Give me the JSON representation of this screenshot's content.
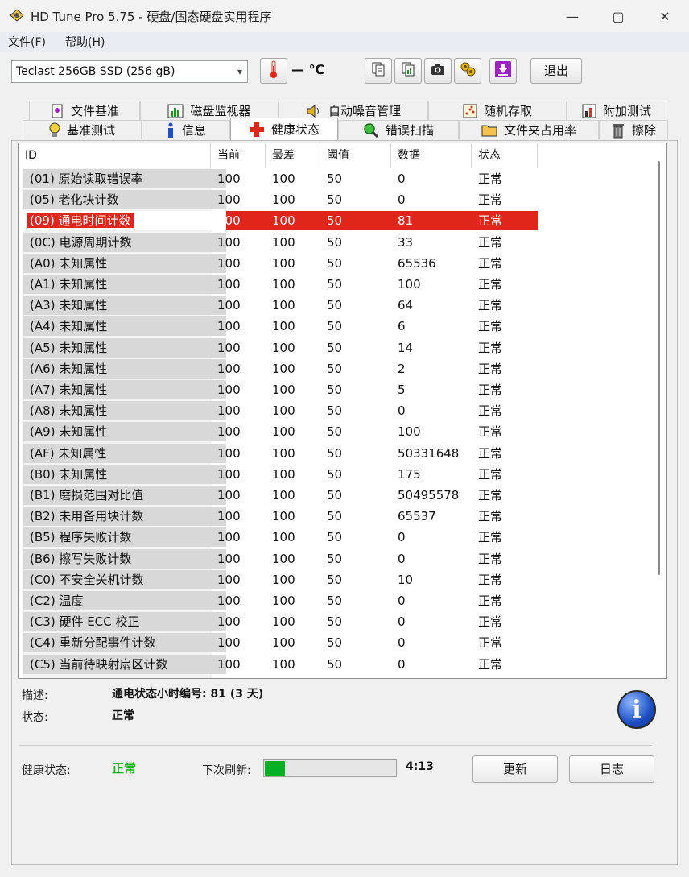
{
  "window": {
    "title": "HD Tune Pro 5.75 - 硬盘/固态硬盘实用程序",
    "minimize": "—",
    "maximize": "▢",
    "close": "✕"
  },
  "menu": {
    "file": "文件(F)",
    "help": "帮助(H)"
  },
  "toolbar": {
    "drive": "Teclast 256GB SSD (256 gB)",
    "temperature": "— ℃",
    "exit": "退出"
  },
  "tabs": {
    "row1": [
      "文件基准",
      "磁盘监视器",
      "自动噪音管理",
      "随机存取",
      "附加测试"
    ],
    "row2": [
      "基准测试",
      "信息",
      "健康状态",
      "错误扫描",
      "文件夹占用率",
      "擦除"
    ],
    "active": "健康状态"
  },
  "table": {
    "headers": [
      "ID",
      "当前",
      "最差",
      "阈值",
      "数据",
      "状态"
    ],
    "selected_index": 2,
    "rows": [
      [
        "(01) 原始读取错误率",
        "100",
        "100",
        "50",
        "0",
        "正常"
      ],
      [
        "(05) 老化块计数",
        "100",
        "100",
        "50",
        "0",
        "正常"
      ],
      [
        "(09) 通电时间计数",
        "100",
        "100",
        "50",
        "81",
        "正常"
      ],
      [
        "(0C) 电源周期计数",
        "100",
        "100",
        "50",
        "33",
        "正常"
      ],
      [
        "(A0) 未知属性",
        "100",
        "100",
        "50",
        "65536",
        "正常"
      ],
      [
        "(A1) 未知属性",
        "100",
        "100",
        "50",
        "100",
        "正常"
      ],
      [
        "(A3) 未知属性",
        "100",
        "100",
        "50",
        "64",
        "正常"
      ],
      [
        "(A4) 未知属性",
        "100",
        "100",
        "50",
        "6",
        "正常"
      ],
      [
        "(A5) 未知属性",
        "100",
        "100",
        "50",
        "14",
        "正常"
      ],
      [
        "(A6) 未知属性",
        "100",
        "100",
        "50",
        "2",
        "正常"
      ],
      [
        "(A7) 未知属性",
        "100",
        "100",
        "50",
        "5",
        "正常"
      ],
      [
        "(A8) 未知属性",
        "100",
        "100",
        "50",
        "0",
        "正常"
      ],
      [
        "(A9) 未知属性",
        "100",
        "100",
        "50",
        "100",
        "正常"
      ],
      [
        "(AF) 未知属性",
        "100",
        "100",
        "50",
        "50331648",
        "正常"
      ],
      [
        "(B0) 未知属性",
        "100",
        "100",
        "50",
        "175",
        "正常"
      ],
      [
        "(B1) 磨损范围对比值",
        "100",
        "100",
        "50",
        "50495578",
        "正常"
      ],
      [
        "(B2) 未用备用块计数",
        "100",
        "100",
        "50",
        "65537",
        "正常"
      ],
      [
        "(B5) 程序失败计数",
        "100",
        "100",
        "50",
        "0",
        "正常"
      ],
      [
        "(B6) 擦写失败计数",
        "100",
        "100",
        "50",
        "0",
        "正常"
      ],
      [
        "(C0) 不安全关机计数",
        "100",
        "100",
        "50",
        "10",
        "正常"
      ],
      [
        "(C2) 温度",
        "100",
        "100",
        "50",
        "0",
        "正常"
      ],
      [
        "(C3) 硬件 ECC 校正",
        "100",
        "100",
        "50",
        "0",
        "正常"
      ],
      [
        "(C4) 重新分配事件计数",
        "100",
        "100",
        "50",
        "0",
        "正常"
      ],
      [
        "(C5) 当前待映射扇区计数",
        "100",
        "100",
        "50",
        "0",
        "正常"
      ]
    ]
  },
  "details": {
    "desc_label": "描述:",
    "desc_value": "通电状态小时编号: 81 (3 天)",
    "status_label": "状态:",
    "status_value": "正常"
  },
  "footer": {
    "health_label": "健康状态:",
    "health_value": "正常",
    "refresh_label": "下次刷新:",
    "refresh_progress": 0.15,
    "countdown": "4:13",
    "update_btn": "更新",
    "log_btn": "日志"
  },
  "colors": {
    "selected": "#e0261a",
    "ok": "#11b311",
    "progress": "#06b025"
  }
}
